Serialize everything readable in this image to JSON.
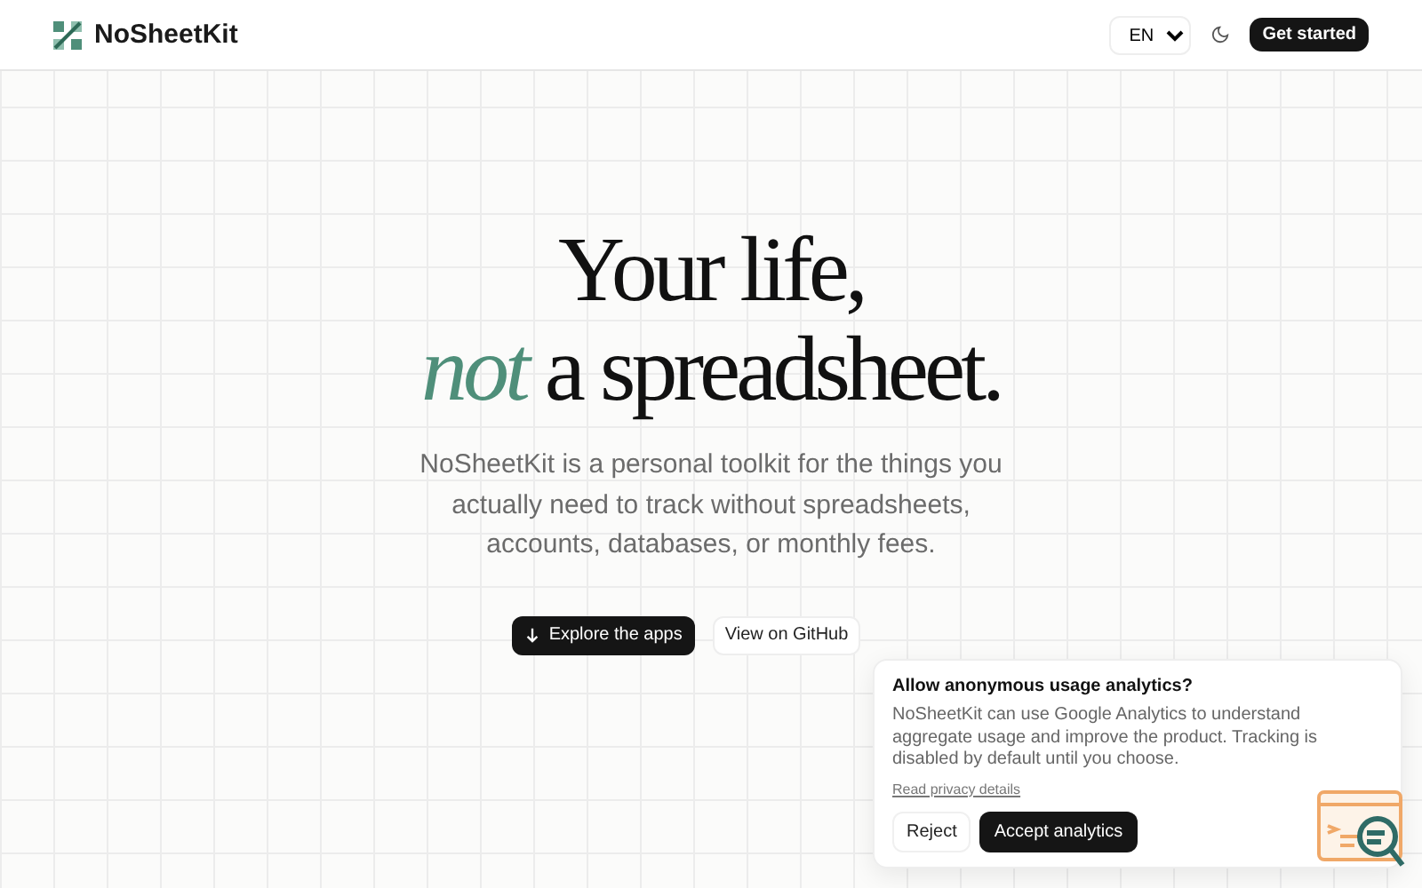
{
  "header": {
    "brand": "NoSheetKit",
    "language": "EN",
    "get_started": "Get started"
  },
  "hero": {
    "title_line_1": "Your life,",
    "title_line_2": "*not* a spreadsheet.",
    "description": "NoSheetKit is a personal toolkit for the things you actually need to track without spreadsheets, accounts, databases, or monthly fees.",
    "primary_button": "Explore the apps",
    "secondary_button": "View on GitHub"
  },
  "consent": {
    "title": "Allow anonymous usage analytics?",
    "body": "NoSheetKit can use Google Analytics to understand aggregate usage and improve the product. Tracking is disabled by default until you choose.",
    "link": "Read privacy details",
    "reject": "Reject",
    "accept": "Accept analytics"
  }
}
